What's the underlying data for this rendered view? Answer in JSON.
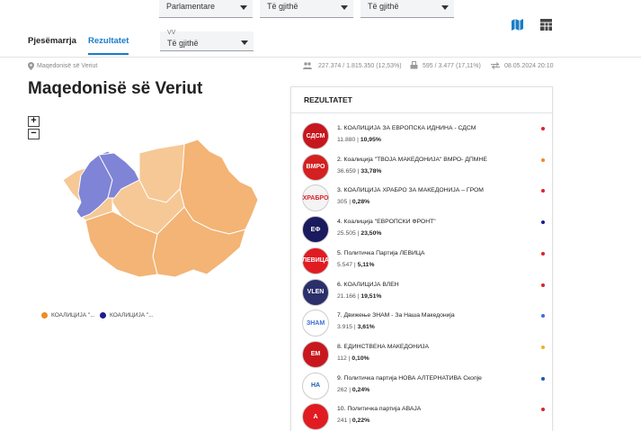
{
  "filters": [
    {
      "value": "Parlamentare"
    },
    {
      "value": "Të gjithë"
    },
    {
      "value": "Të gjithë"
    }
  ],
  "vv_filter": {
    "label": "VV",
    "value": "Të gjithë"
  },
  "tabs": [
    {
      "label": "Pjesëmarrja"
    },
    {
      "label": "Rezultatet"
    }
  ],
  "meta": {
    "location": "Maqedonisë së Veriut",
    "voters": "227.374 / 1.815.350 (12,53%)",
    "stations": "595 / 3.477 (17,11%)",
    "timestamp": "08.05.2024 20:10"
  },
  "page_title": "Maqedonisë së Veriut",
  "zoom": {
    "in": "+",
    "out": "−"
  },
  "map_legend": [
    {
      "label": "КОАЛИЦИЈА \"...",
      "color": "#f08a24"
    },
    {
      "label": "КОАЛИЦИЈА \"...",
      "color": "#1c1f8c"
    }
  ],
  "map_colors": {
    "light": "#f6c896",
    "mid": "#f3b475",
    "blue": "#7f84d6"
  },
  "results": {
    "title": "REZULTATET",
    "parties": [
      {
        "name": "1. КОАЛИЦИЈА ЗА ЕВРОПСКА ИДНИНА - СДСМ",
        "votes": "11.880",
        "pct": "10,95%",
        "color": "#d9262b",
        "logo_text": "СДСМ",
        "logo_bg": "#c7161e"
      },
      {
        "name": "2. Коалиција \"ТВОЈА МАКЕДОНИЈА\" ВМРО- ДПМНЕ",
        "votes": "36.659",
        "pct": "33,78%",
        "color": "#f08a24",
        "logo_text": "ВМРО",
        "logo_bg": "#d42020"
      },
      {
        "name": "3. КОАЛИЦИЈА ХРАБРО ЗА МАКЕДОНИЈА – ГРОМ",
        "votes": "305",
        "pct": "0,28%",
        "color": "#d9262b",
        "logo_text": "ХРАБРО",
        "logo_bg": "#f4f4f4"
      },
      {
        "name": "4. Коалиција \"ЕВРОПСКИ ФРОНТ\"",
        "votes": "25.505",
        "pct": "23,50%",
        "color": "#1c1f8c",
        "logo_text": "ЕФ",
        "logo_bg": "#1a1a5e"
      },
      {
        "name": "5. Политичка Партија ЛЕВИЦА",
        "votes": "5.547",
        "pct": "5,11%",
        "color": "#d9262b",
        "logo_text": "ЛЕВИЦА",
        "logo_bg": "#e11b22"
      },
      {
        "name": "6. КОАЛИЦИЈА ВЛЕН",
        "votes": "21.166",
        "pct": "19,51%",
        "color": "#d9262b",
        "logo_text": "VLEN",
        "logo_bg": "#2b2f6b"
      },
      {
        "name": "7. Движење ЗНАМ - За Наша Македонија",
        "votes": "3.915",
        "pct": "3,61%",
        "color": "#3f6fd1",
        "logo_text": "ЗНАМ",
        "logo_bg": "#ffffff"
      },
      {
        "name": "8. ЕДИНСТВЕНА МАКЕДОНИЈА",
        "votes": "112",
        "pct": "0,10%",
        "color": "#f0b02a",
        "logo_text": "ЕМ",
        "logo_bg": "#c8181e"
      },
      {
        "name": "9. Политичка партија НОВА АЛТЕРНАТИВА Скопје",
        "votes": "262",
        "pct": "0,24%",
        "color": "#1c5bb0",
        "logo_text": "НА",
        "logo_bg": "#ffffff"
      },
      {
        "name": "10. Политичка партија АВАЈА",
        "votes": "241",
        "pct": "0,22%",
        "color": "#d9262b",
        "logo_text": "А",
        "logo_bg": "#e11b22"
      }
    ]
  }
}
